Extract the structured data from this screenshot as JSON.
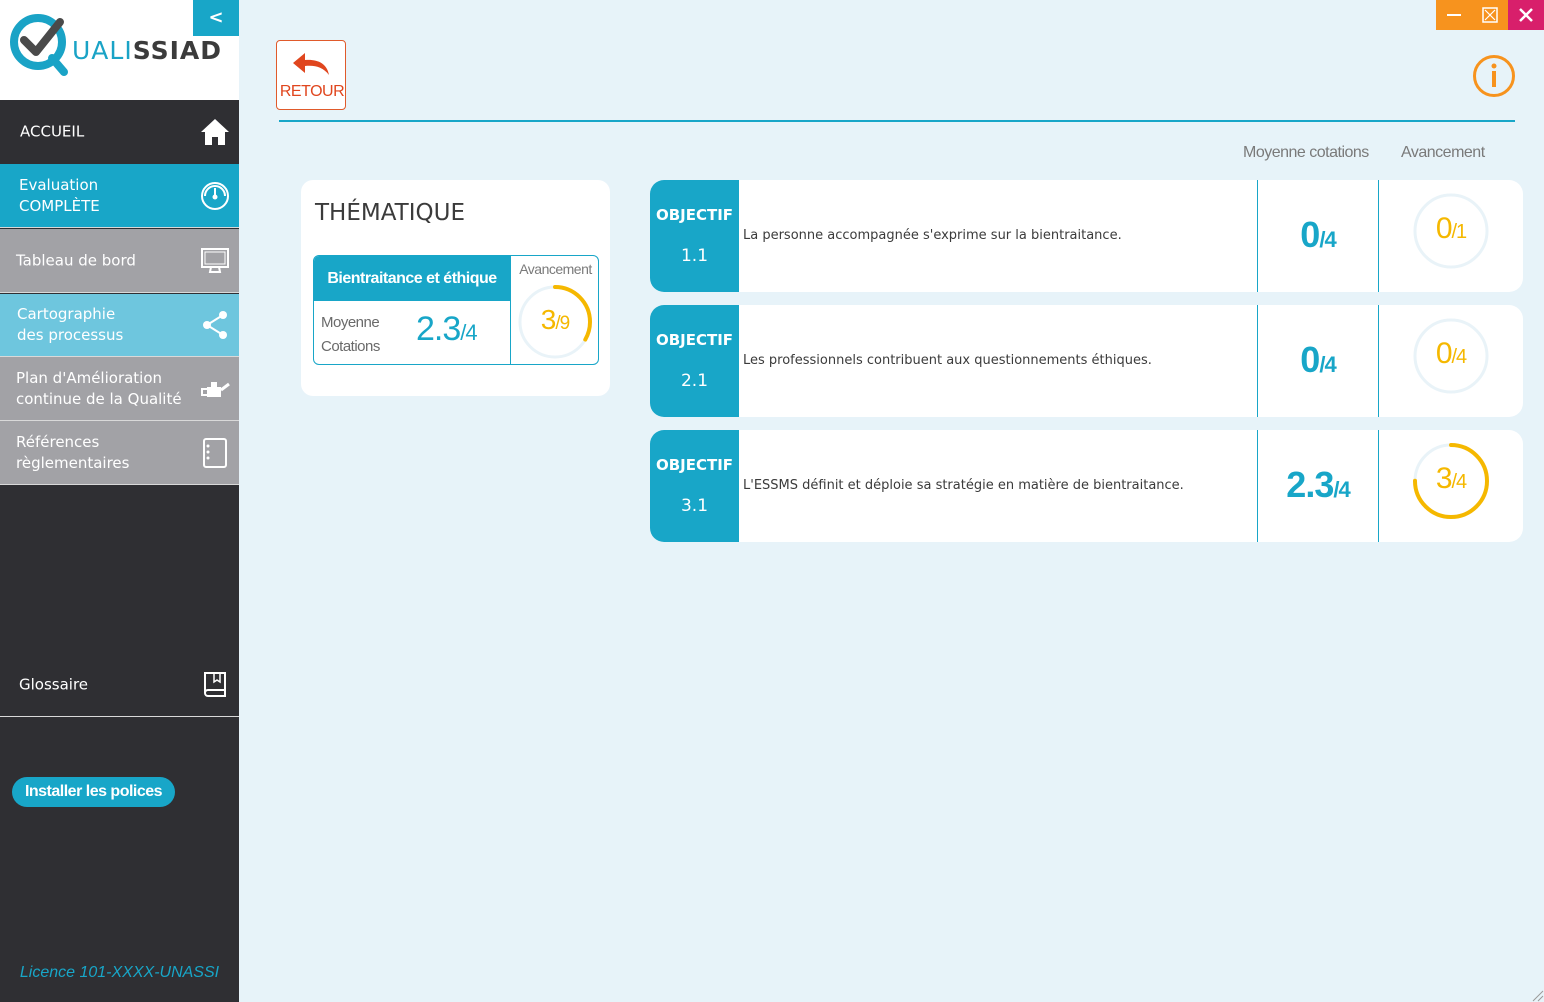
{
  "app": {
    "logo_prefix": "UALI",
    "logo_suffix": "SSIAD",
    "collapse_label": "<"
  },
  "sidebar": {
    "items": [
      {
        "id": "accueil",
        "label": "ACCUEIL",
        "icon": "home-icon"
      },
      {
        "id": "evaluation",
        "label_line1": "Evaluation",
        "label_line2": "COMPLÈTE",
        "icon": "gauge-icon",
        "active": true
      },
      {
        "id": "tableau",
        "label": "Tableau de bord",
        "icon": "monitor-icon"
      },
      {
        "id": "cartographie",
        "label_line1": "Cartographie",
        "label_line2": "des processus",
        "icon": "share-icon"
      },
      {
        "id": "plan",
        "label_line1": "Plan d'Amélioration",
        "label_line2": "continue de la Qualité",
        "icon": "watering-can-icon"
      },
      {
        "id": "references",
        "label_line1": "Références",
        "label_line2": "règlementaires",
        "icon": "notebook-icon"
      },
      {
        "id": "glossaire",
        "label": "Glossaire",
        "icon": "book-icon"
      }
    ],
    "install_button": "Installer les polices",
    "licence": "Licence 101-XXXX-UNASSI"
  },
  "header": {
    "back_label": "RETOUR",
    "col_moyenne": "Moyenne cotations",
    "col_avancement": "Avancement"
  },
  "thematique": {
    "title": "THÉMATIQUE",
    "name": "Bientraitance et éthique",
    "moyenne_label_line1": "Moyenne",
    "moyenne_label_line2": "Cotations",
    "moyenne_value": "2.3",
    "moyenne_den": "/4",
    "avancement_label": "Avancement",
    "avancement_value": "3",
    "avancement_den": "/9",
    "avancement_fraction": 0.3333
  },
  "objectifs": [
    {
      "tag": "OBJECTIF",
      "num": "1.1",
      "text": "La personne accompagnée s'exprime sur la bientraitance.",
      "moy": "0",
      "moy_den": "/4",
      "av": "0",
      "av_den": "/1",
      "av_fraction": 0
    },
    {
      "tag": "OBJECTIF",
      "num": "2.1",
      "text": "Les professionnels contribuent aux questionnements éthiques.",
      "moy": "0",
      "moy_den": "/4",
      "av": "0",
      "av_den": "/4",
      "av_fraction": 0
    },
    {
      "tag": "OBJECTIF",
      "num": "3.1",
      "text": "L'ESSMS définit et déploie sa stratégie en matière de bientraitance.",
      "moy": "2.3",
      "moy_den": "/4",
      "av": "3",
      "av_den": "/4",
      "av_fraction": 0.75
    }
  ],
  "colors": {
    "accent": "#18a6c8",
    "sidebar_bg": "#2f2f33",
    "progress": "#f5b800",
    "retour": "#e0461e",
    "info": "#f7931e"
  }
}
